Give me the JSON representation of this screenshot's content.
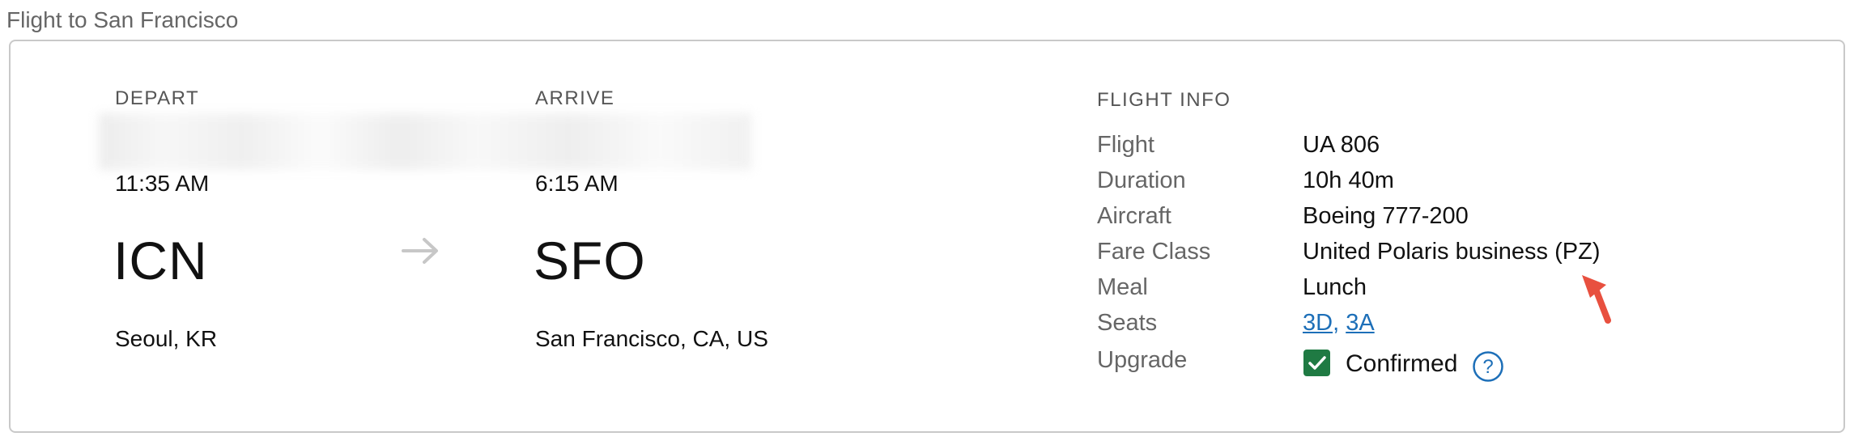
{
  "section": {
    "title": "Flight to San Francisco"
  },
  "depart": {
    "label": "DEPART",
    "time": "11:35 AM",
    "code": "ICN",
    "city": "Seoul, KR"
  },
  "arrive": {
    "label": "ARRIVE",
    "time": "6:15 AM",
    "code": "SFO",
    "city": "San Francisco, CA, US"
  },
  "route_icon": "arrow-right-icon",
  "flight_info": {
    "title": "FLIGHT INFO",
    "rows": [
      {
        "label": "Flight",
        "value": "UA 806"
      },
      {
        "label": "Duration",
        "value": "10h 40m"
      },
      {
        "label": "Aircraft",
        "value": "Boeing 777-200"
      },
      {
        "label": "Fare Class",
        "value": "United Polaris business (PZ)"
      },
      {
        "label": "Meal",
        "value": "Lunch"
      }
    ],
    "seats": {
      "label": "Seats",
      "items": [
        "3D",
        "3A"
      ],
      "separator": ","
    },
    "upgrade": {
      "label": "Upgrade",
      "status": "Confirmed",
      "checked": true
    }
  },
  "colors": {
    "link": "#1d6fb8",
    "check": "#1f7a43",
    "annotation": "#e8503f",
    "muted_text": "#666666",
    "border": "#c9c9c9"
  },
  "icons": {
    "check": "checkmark-icon",
    "help": "help-circle-icon",
    "annotation": "red-arrow-pointer-icon"
  }
}
